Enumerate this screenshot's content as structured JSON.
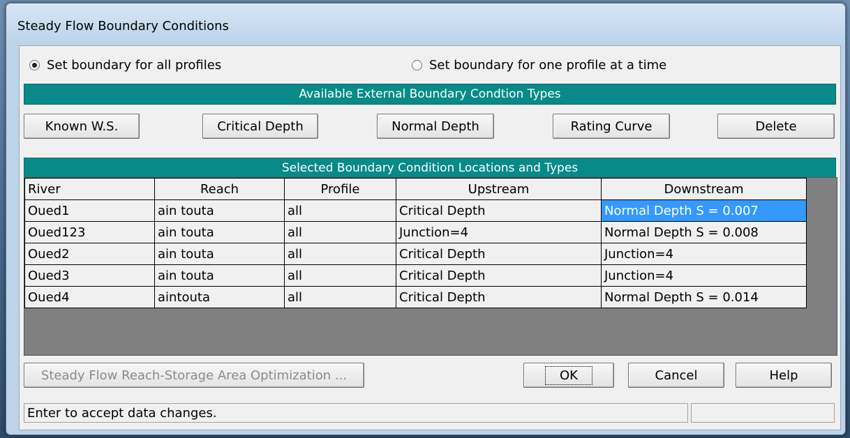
{
  "window": {
    "title": "Steady Flow Boundary Conditions"
  },
  "mode": {
    "all_profiles_label": "Set boundary for all profiles",
    "one_profile_label": "Set boundary for one profile at a time",
    "selected": "all"
  },
  "types_header": "Available External Boundary Condtion Types",
  "type_buttons": {
    "known_ws": "Known W.S.",
    "critical_depth": "Critical Depth",
    "normal_depth": "Normal Depth",
    "rating_curve": "Rating Curve",
    "delete": "Delete"
  },
  "locations_header": "Selected Boundary Condition Locations and Types",
  "table": {
    "columns": [
      "River",
      "Reach",
      "Profile",
      "Upstream",
      "Downstream"
    ],
    "rows": [
      [
        "Oued1",
        "ain touta",
        "all",
        "Critical Depth",
        "Normal Depth S = 0.007"
      ],
      [
        "Oued123",
        "ain touta",
        "all",
        "Junction=4",
        "Normal Depth S = 0.008"
      ],
      [
        "Oued2",
        "ain touta",
        "all",
        "Critical Depth",
        "Junction=4"
      ],
      [
        "Oued3",
        "ain touta",
        "all",
        "Critical Depth",
        "Junction=4"
      ],
      [
        "Oued4",
        "aintouta",
        "all",
        "Critical Depth",
        "Normal Depth S = 0.014"
      ]
    ]
  },
  "bottom_buttons": {
    "optimization": "Steady Flow Reach-Storage Area Optimization ...",
    "ok": "OK",
    "cancel": "Cancel",
    "help": "Help"
  },
  "status_text": "Enter to accept data changes.",
  "colors": {
    "header_band": "#088a88",
    "selection": "#3399ff",
    "grid_bg": "#808080"
  }
}
